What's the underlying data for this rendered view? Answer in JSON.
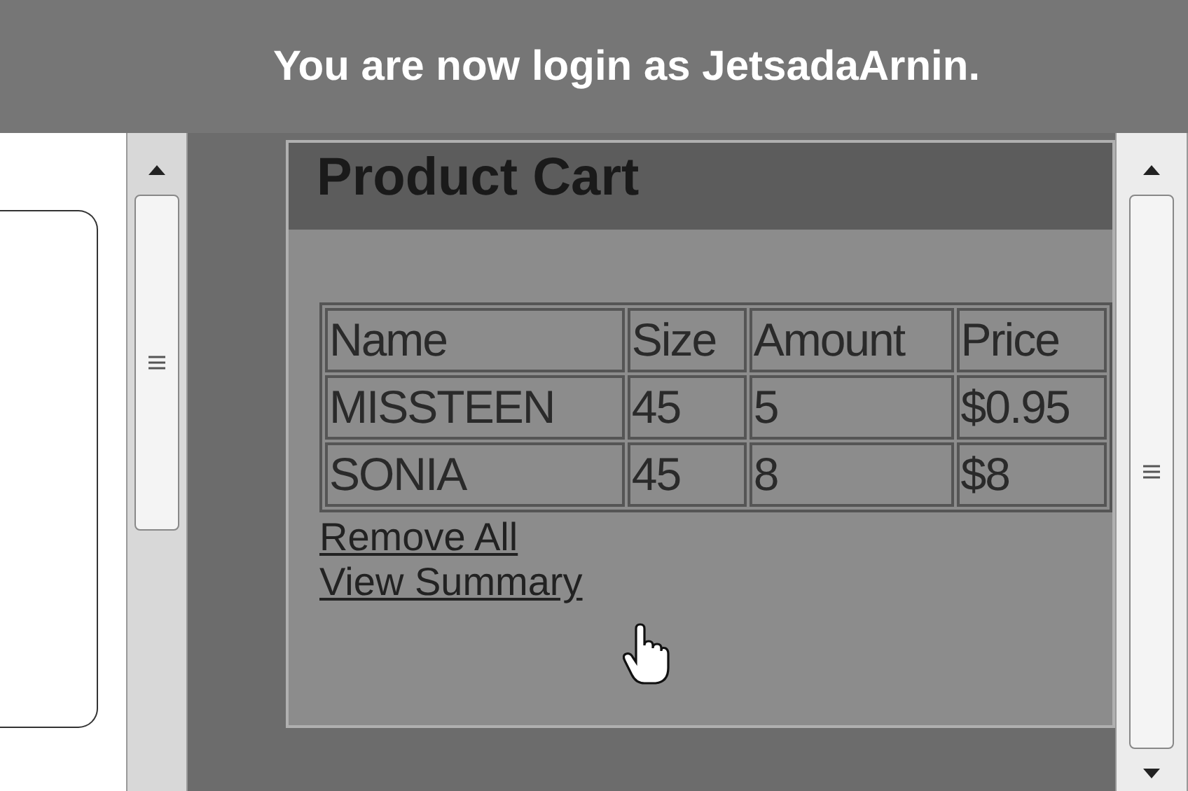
{
  "banner": {
    "text": "You are now login as JetsadaArnin."
  },
  "cart": {
    "title": "Product Cart",
    "table": {
      "columns": [
        "Name",
        "Size",
        "Amount",
        "Price"
      ],
      "rows": [
        [
          "MISSTEEN",
          "45",
          "5",
          "$0.95"
        ],
        [
          "SONIA",
          "45",
          "8",
          "$8"
        ]
      ]
    },
    "links": [
      "Remove All",
      "View Summary"
    ]
  }
}
